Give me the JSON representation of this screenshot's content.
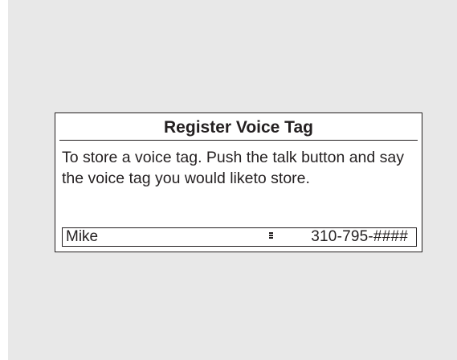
{
  "dialog": {
    "title": "Register Voice Tag",
    "message": "To store a voice tag. Push the talk button and say the voice tag you would liketo store."
  },
  "entry": {
    "name": "Mike",
    "phone_type_icon": "phone-list-icon",
    "number": "310-795-####"
  },
  "colors": {
    "screen_background": "#e8e8e8",
    "dialog_background": "#ffffff",
    "text": "#231f20"
  }
}
